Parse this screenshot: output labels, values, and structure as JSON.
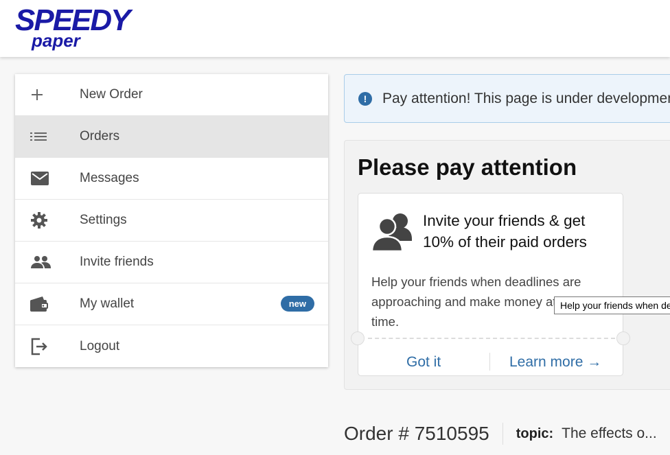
{
  "brand": {
    "logo_text_main": "SPEEDY",
    "logo_text_sub": "paper",
    "color": "#1a1aa6"
  },
  "sidebar": {
    "items": [
      {
        "label": "New Order",
        "icon": "plus-icon"
      },
      {
        "label": "Orders",
        "icon": "list-icon",
        "active": true
      },
      {
        "label": "Messages",
        "icon": "envelope-icon"
      },
      {
        "label": "Settings",
        "icon": "gear-icon"
      },
      {
        "label": "Invite friends",
        "icon": "people-icon"
      },
      {
        "label": "My wallet",
        "icon": "wallet-icon",
        "badge": "new"
      },
      {
        "label": "Logout",
        "icon": "logout-icon"
      }
    ]
  },
  "alert": {
    "text": "Pay attention! This page is under development"
  },
  "panel": {
    "title": "Please pay attention",
    "card": {
      "heading": "Invite your friends & get 10% of their paid orders",
      "body": "Help your friends when deadlines are approaching and make money at the same time.",
      "got_it": "Got it",
      "learn_more": "Learn more →"
    }
  },
  "tooltip": {
    "text": "Help your friends when deadlines are approaching"
  },
  "order": {
    "number": "Order # 7510595",
    "topic_label": "topic:",
    "topic_value": "The effects o..."
  },
  "colors": {
    "accent": "#2f6da6",
    "badge": "#2f6da6",
    "active_bg": "#e5e5e5"
  }
}
